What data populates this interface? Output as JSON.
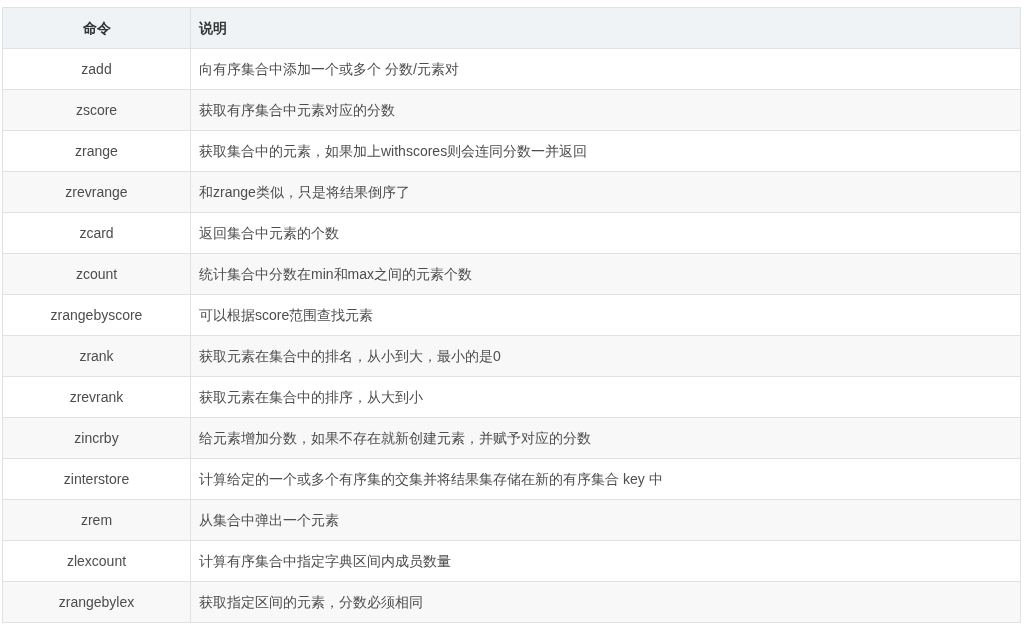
{
  "table": {
    "columns": [
      "命令",
      "说明"
    ],
    "rows": [
      {
        "command": "zadd",
        "description": "向有序集合中添加一个或多个 分数/元素对"
      },
      {
        "command": "zscore",
        "description": "获取有序集合中元素对应的分数"
      },
      {
        "command": "zrange",
        "description": "获取集合中的元素，如果加上withscores则会连同分数一并返回"
      },
      {
        "command": "zrevrange",
        "description": "和zrange类似，只是将结果倒序了"
      },
      {
        "command": "zcard",
        "description": "返回集合中元素的个数"
      },
      {
        "command": "zcount",
        "description": "统计集合中分数在min和max之间的元素个数"
      },
      {
        "command": "zrangebyscore",
        "description": "可以根据score范围查找元素"
      },
      {
        "command": "zrank",
        "description": "获取元素在集合中的排名，从小到大，最小的是0"
      },
      {
        "command": "zrevrank",
        "description": "获取元素在集合中的排序，从大到小"
      },
      {
        "command": "zincrby",
        "description": "给元素增加分数，如果不存在就新创建元素，并赋予对应的分数"
      },
      {
        "command": "zinterstore",
        "description": "计算给定的一个或多个有序集的交集并将结果集存储在新的有序集合 key 中"
      },
      {
        "command": "zrem",
        "description": "从集合中弹出一个元素"
      },
      {
        "command": "zlexcount",
        "description": "计算有序集合中指定字典区间内成员数量"
      },
      {
        "command": "zrangebylex",
        "description": "获取指定区间的元素，分数必须相同"
      }
    ]
  }
}
